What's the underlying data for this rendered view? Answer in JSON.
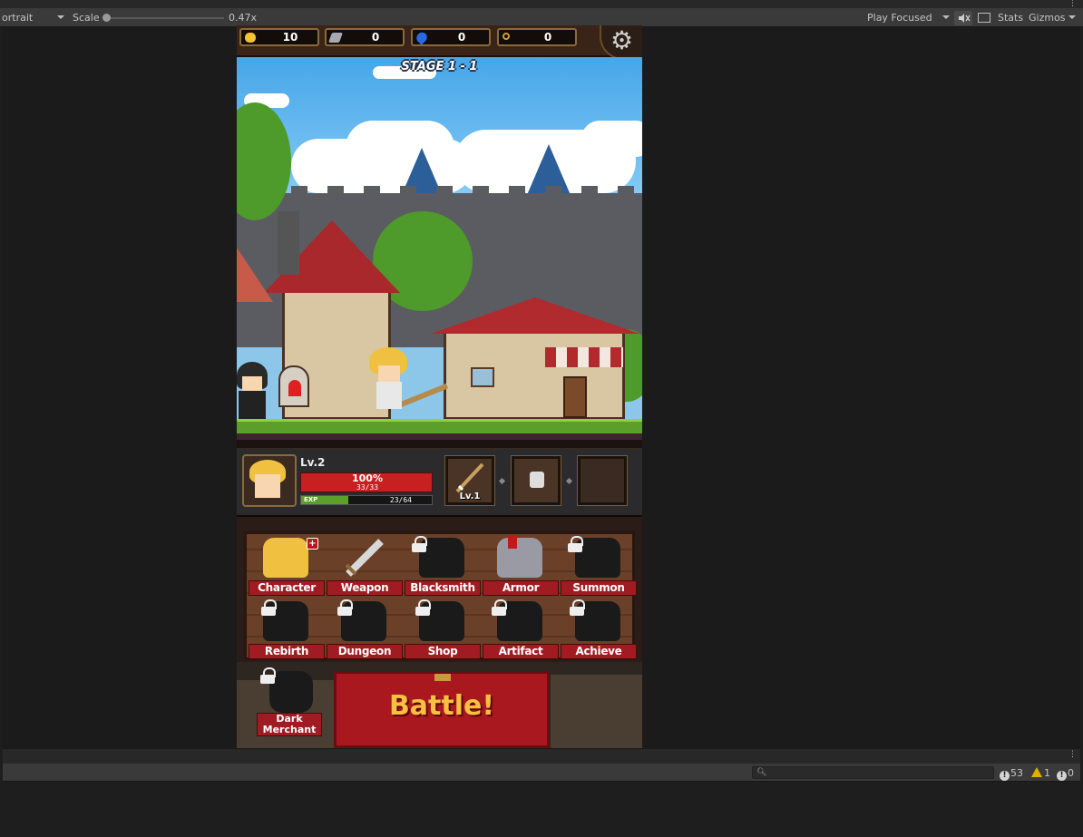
{
  "toolbar": {
    "aspect": "ortrait",
    "scale_label": "Scale",
    "scale_value": "0.47x",
    "play_mode": "Play Focused",
    "stats": "Stats",
    "gizmos": "Gizmos"
  },
  "game": {
    "resources": [
      {
        "icon": "gold-coin-icon",
        "value": "10"
      },
      {
        "icon": "iron-ore-icon",
        "value": "0"
      },
      {
        "icon": "blue-gem-icon",
        "value": "0"
      },
      {
        "icon": "key-icon",
        "value": "0"
      }
    ],
    "stage_title": "STAGE 1 - 1",
    "player": {
      "level": "Lv.2",
      "hp_percent_label": "100%",
      "hp_values": "33/33",
      "exp_label": "EXP",
      "exp_values": "23/64",
      "exp_fraction": 0.36
    },
    "equipment": [
      {
        "icon": "sword-icon",
        "level": "Lv.1"
      },
      {
        "icon": "armor-icon",
        "level": ""
      },
      {
        "icon": "empty-slot-icon",
        "level": ""
      }
    ],
    "menu": [
      {
        "label": "Character",
        "locked": false,
        "icon": "character-icon"
      },
      {
        "label": "Weapon",
        "locked": false,
        "icon": "weapon-icon"
      },
      {
        "label": "Blacksmith",
        "locked": true,
        "icon": "blacksmith-icon"
      },
      {
        "label": "Armor",
        "locked": false,
        "icon": "armor-icon"
      },
      {
        "label": "Summon",
        "locked": true,
        "icon": "summon-icon"
      },
      {
        "label": "Rebirth",
        "locked": true,
        "icon": "rebirth-icon"
      },
      {
        "label": "Dungeon",
        "locked": true,
        "icon": "dungeon-icon"
      },
      {
        "label": "Shop",
        "locked": true,
        "icon": "shop-icon"
      },
      {
        "label": "Artifact",
        "locked": true,
        "icon": "artifact-icon"
      },
      {
        "label": "Achieve",
        "locked": true,
        "icon": "achieve-icon"
      }
    ],
    "dark_merchant_line1": "Dark",
    "dark_merchant_line2": "Merchant",
    "battle_label": "Battle!"
  },
  "console": {
    "errors": "53",
    "warnings": "1",
    "messages": "0"
  },
  "colors": {
    "editor_bg": "#1e1e1e",
    "toolbar_bg": "#3a3a3a",
    "menu_label_red": "#a01c22",
    "hp_red": "#c82020",
    "exp_green": "#5aa02a",
    "battle_text": "#f8c040"
  }
}
